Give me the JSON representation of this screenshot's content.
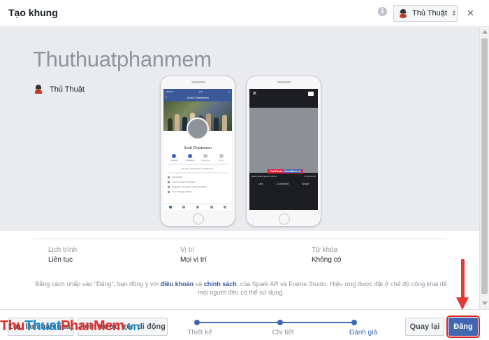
{
  "dialog": {
    "title": "Tạo khung",
    "info_icon": "info-icon",
    "close_icon": "close-icon",
    "account": {
      "name": "Thủ Thuật",
      "arrows": "⇕"
    }
  },
  "preview": {
    "frame_name": "Thuthuatphanmem",
    "owner": "Thủ Thuật",
    "profile_phone": {
      "nav_title": "Scott Christensen",
      "status_left": "●●●●● ▾",
      "status_time": "1:20",
      "name": "Scott Christensen",
      "actions": [
        "Friends",
        "Following",
        "Message",
        "More"
      ],
      "bio": "Be nice, the world is a small town.",
      "rows": [
        "Accountant",
        "Lives in Lisbon, Portugal",
        "Studied at University of Pennsylvania",
        "From Chicago, Illinois"
      ]
    },
    "photo_phone": {
      "overlay_part1": "ThuThuat",
      "overlay_part2": "PhanMem.vn",
      "reactions": "Justin Evans and 12 others",
      "comments": "3 Comments",
      "actions": [
        "Like",
        "Comment",
        "Share"
      ]
    }
  },
  "details": {
    "schedule": {
      "label": "Lịch trình",
      "value": "Liên tục"
    },
    "location": {
      "label": "Vị trí",
      "value": "Mọi vị trí"
    },
    "keywords": {
      "label": "Từ khóa",
      "value": "Không có"
    },
    "legal": {
      "before_terms": "Bằng cách nhấp vào \"Đăng\", bạn đồng ý với ",
      "terms_link": "điều khoản",
      "and": " và ",
      "policy_link": "chính sách",
      "after": ". của Spark AR và Frame Studio. Hiệu ứng được đặt ở chế độ công khai để mọi người đều có thể sử dụng."
    }
  },
  "footer": {
    "save_draft": "Lưu làm bản nháp",
    "preview_mobile": "Xem trước trên di động",
    "steps": [
      {
        "label": "Thiết kế"
      },
      {
        "label": "Chi tiết"
      },
      {
        "label": "Đánh giá",
        "active": true
      }
    ],
    "back": "Quay lại",
    "publish": "Đăng"
  },
  "watermark": {
    "part1": "Thu",
    "part2": "Thuat",
    "part3": "PhanMem",
    "part4": ".vn"
  },
  "colors": {
    "accent": "#4267b2",
    "highlight": "#e53935"
  }
}
